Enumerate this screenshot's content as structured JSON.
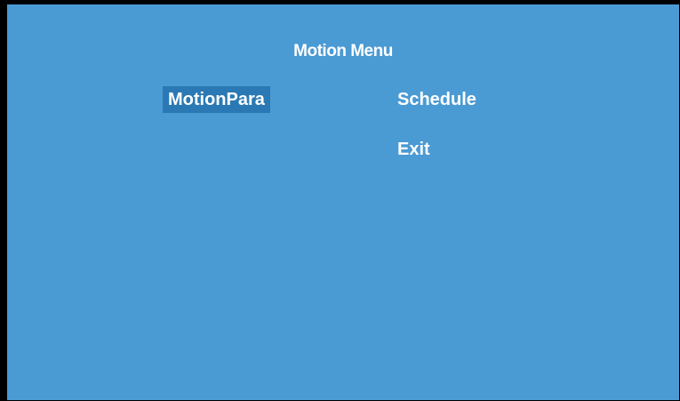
{
  "menu": {
    "title": "Motion Menu",
    "items": [
      {
        "label": "MotionPara",
        "selected": true
      },
      {
        "label": "Schedule",
        "selected": false
      },
      {
        "label": "Exit",
        "selected": false
      }
    ]
  },
  "colors": {
    "background": "#4a9ad4",
    "selection": "#2a79b4",
    "text": "#ffffff",
    "frame": "#000000"
  }
}
